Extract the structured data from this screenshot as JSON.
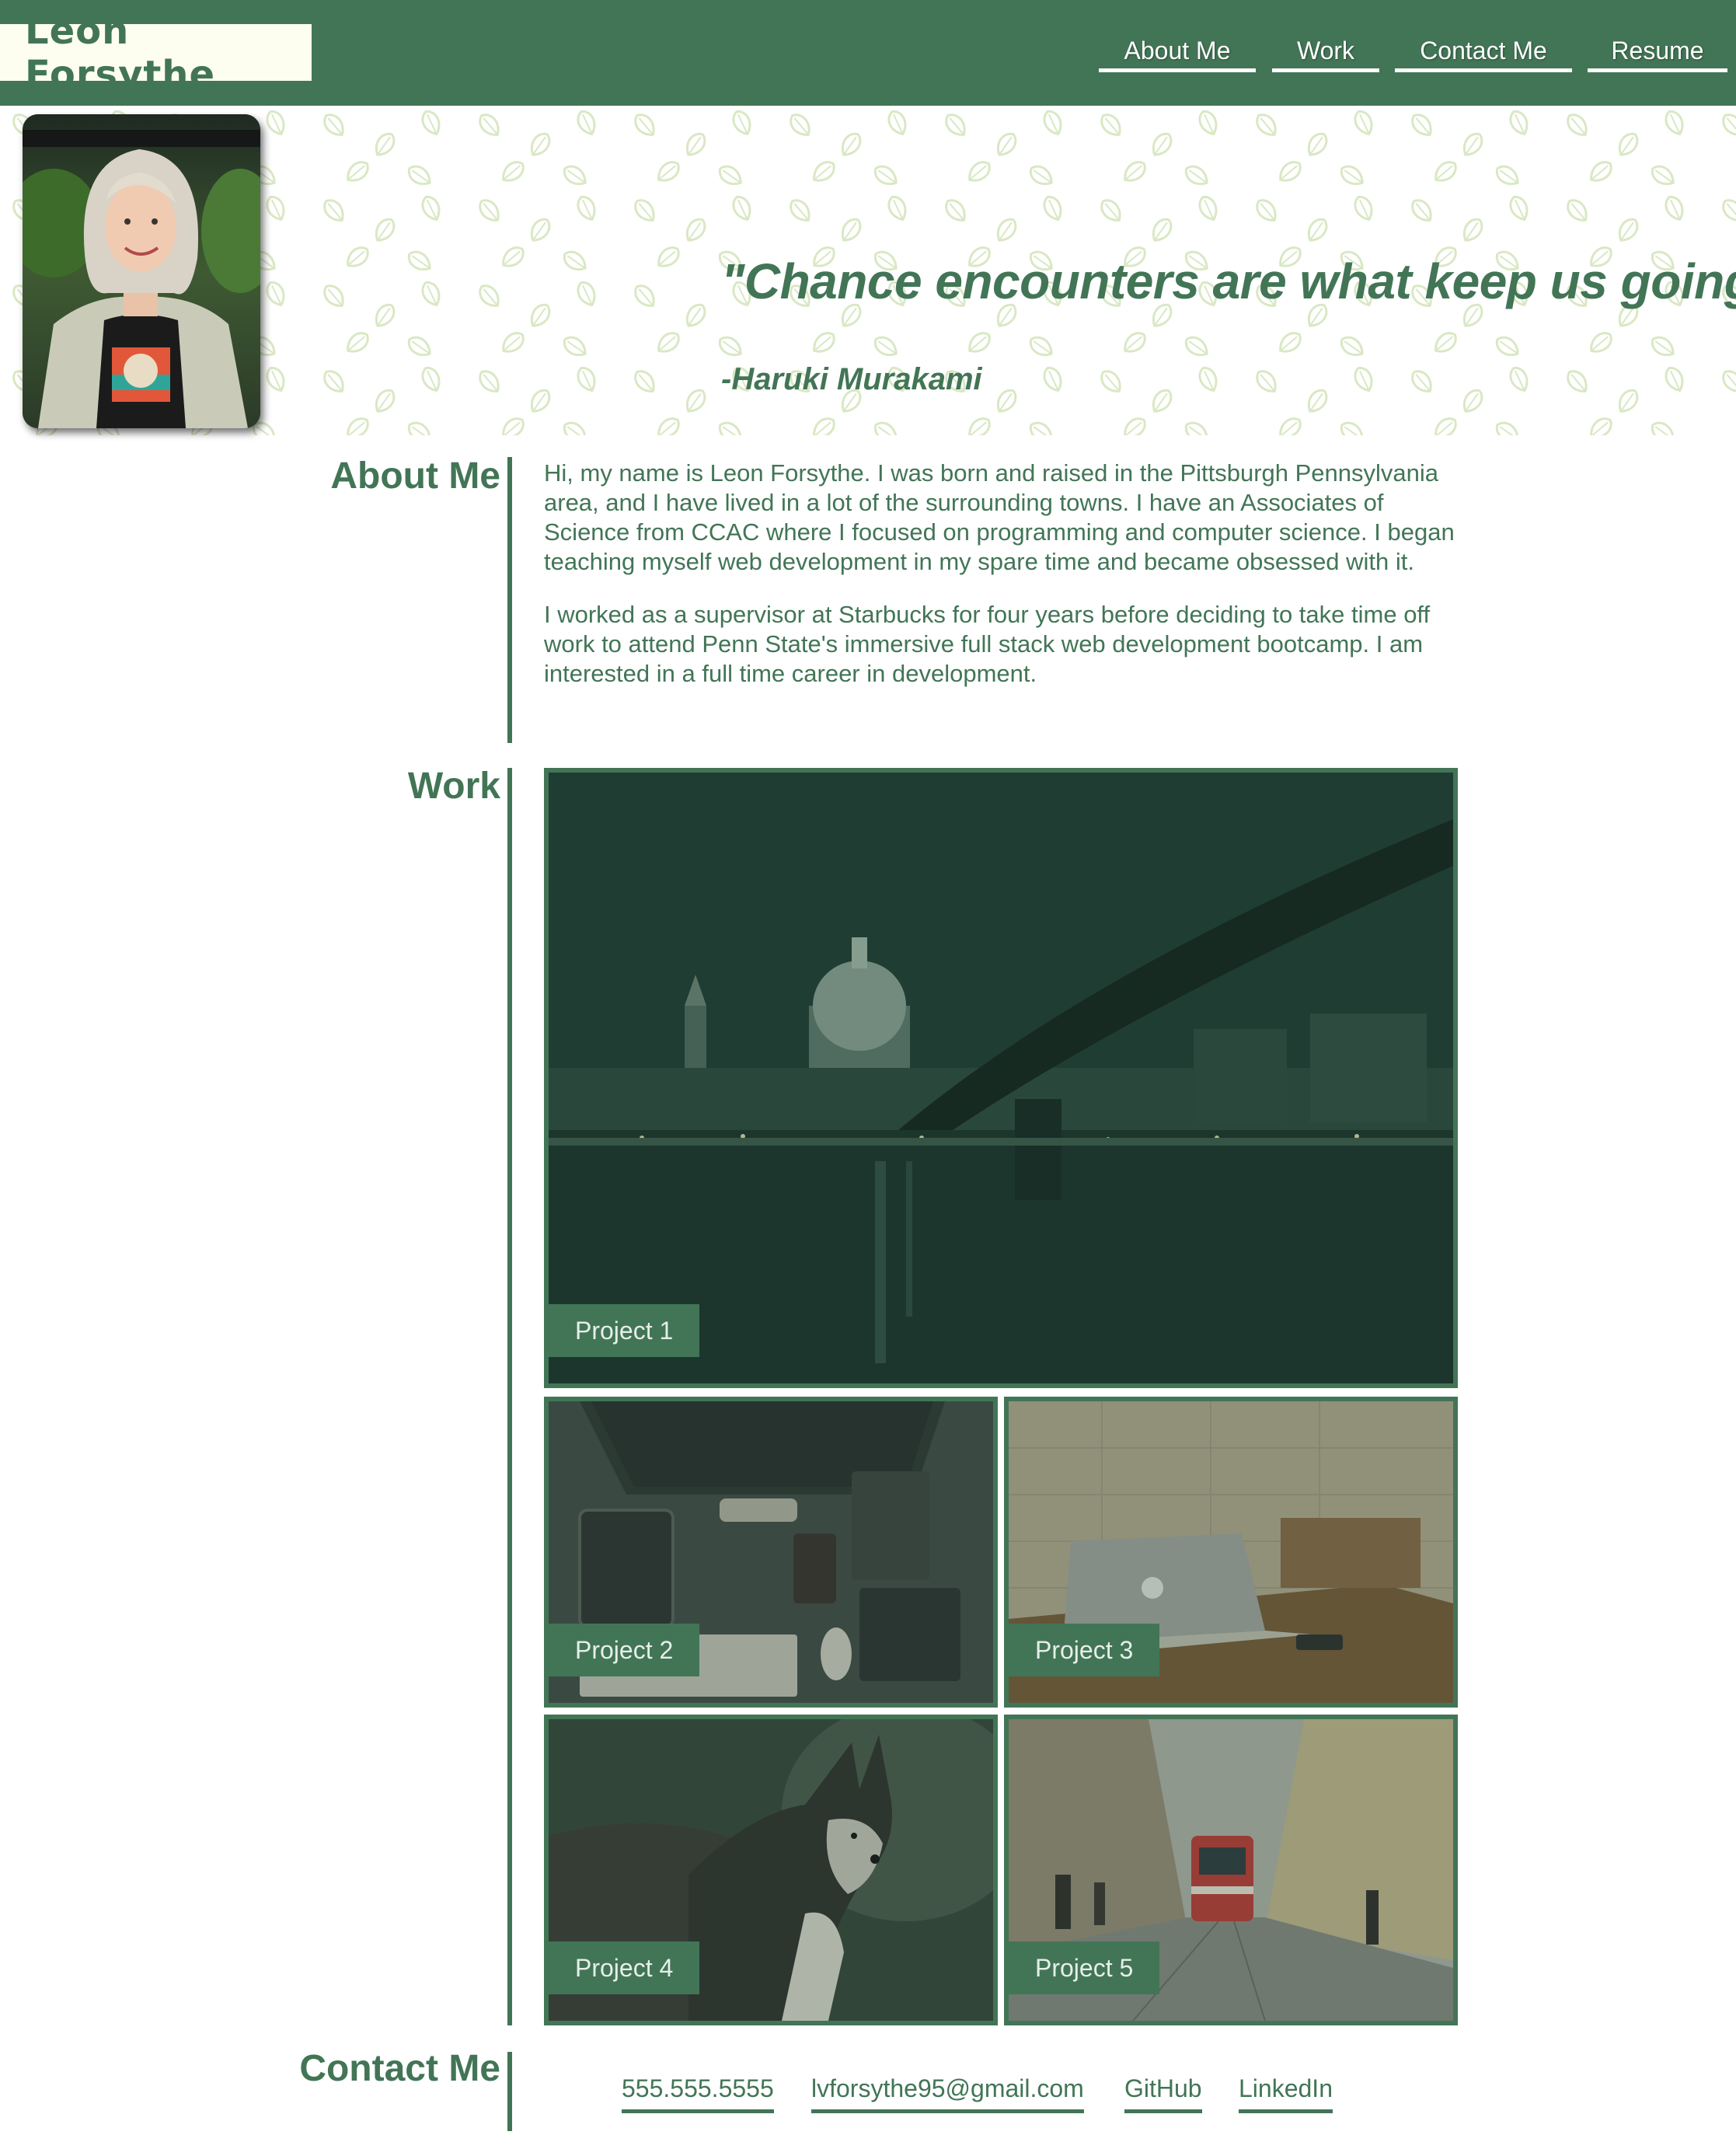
{
  "header": {
    "brand": "Leon Forsythe",
    "nav": [
      "About Me",
      "Work",
      "Contact Me",
      "Resume"
    ]
  },
  "hero": {
    "quote": "\"Chance encounters are what keep us going.\"",
    "author": "-Haruki Murakami",
    "background_icon": "leaf-icon"
  },
  "about": {
    "title": "About Me",
    "paragraphs": [
      "Hi, my name is Leon Forsythe. I was born and raised in the Pittsburgh Pennsylvania area, and I have lived in a lot of the surrounding towns. I have an Associates of Science from CCAC where I focused on programming and computer science. I began teaching myself web development in my spare time and became obsessed with it.",
      "I worked as a supervisor at Starbucks for four years before deciding to take time off work to attend Penn State's immersive full stack web development bootcamp. I am interested in a full time career in development."
    ]
  },
  "work": {
    "title": "Work",
    "projects": [
      "Project 1",
      "Project 2",
      "Project 3",
      "Project 4",
      "Project 5"
    ]
  },
  "contact": {
    "title": "Contact Me",
    "links": [
      "555.555.5555",
      "lvforsythe95@gmail.com",
      "GitHub",
      "LinkedIn"
    ]
  },
  "colors": {
    "primary": "#427556",
    "brand_bg": "#fdfdf0",
    "leaf_pattern": "#d9e8c4"
  }
}
